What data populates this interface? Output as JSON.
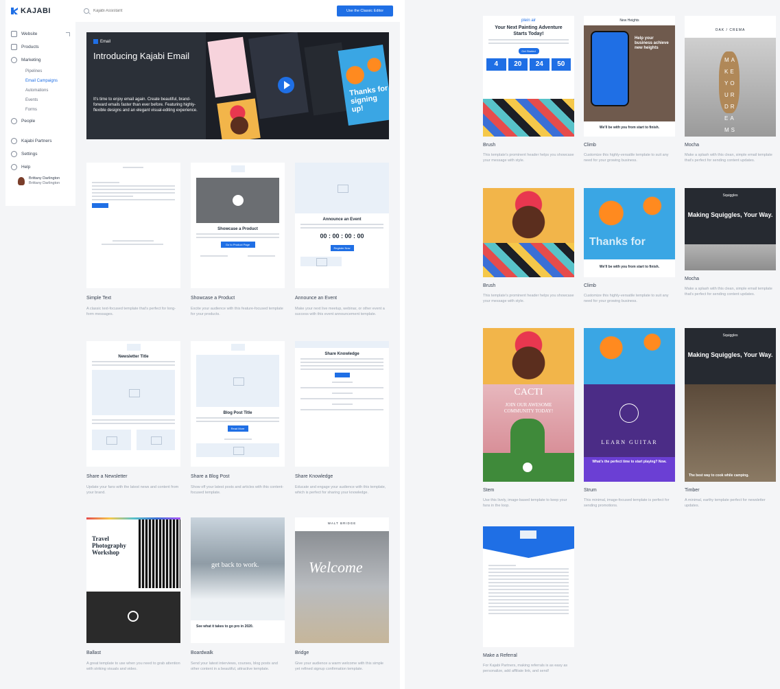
{
  "left": {
    "logo": "KAJABI",
    "nav": {
      "website": "Website",
      "products": "Products",
      "marketing": "Marketing",
      "marketing_sub": [
        "Pipelines",
        "Email Campaigns",
        "Automations",
        "Events",
        "Forms"
      ],
      "people": "People",
      "partners": "Kajabi Partners",
      "settings": "Settings",
      "help": "Help"
    },
    "profile": {
      "name": "Brittany Darlington",
      "sub": "Brittany Darlington"
    },
    "search": {
      "placeholder": "Kajabi Assistant"
    },
    "classic_button": "Use the Classic Editor",
    "hero": {
      "badge": "Email",
      "title": "Introducing Kajabi Email",
      "description": "It's time to enjoy email again. Create beautiful, brand-forward emails faster than ever before. Featuring highly-flexible designs and an elegant visual-editing experience.",
      "thanks": "Thanks for signing up!"
    },
    "templates": [
      {
        "name": "Simple Text",
        "desc": "A classic text-focused template that's perfect for long-form messages."
      },
      {
        "name": "Showcase a Product",
        "desc": "Excite your audience with this feature-focused template for your products.",
        "thumb_title": "Showcase a Product",
        "thumb_btn": "Go to Product Page"
      },
      {
        "name": "Announce an Event",
        "desc": "Make your next live meetup, webinar, or other event a success with this event announcement template.",
        "thumb_title": "Announce an Event",
        "countdown": "00 : 00 : 00 : 00",
        "thumb_btn": "Register Now"
      },
      {
        "name": "Share a Newsletter",
        "desc": "Update your fans with the latest news and content from your brand.",
        "thumb_title": "Newsletter Title"
      },
      {
        "name": "Share a Blog Post",
        "desc": "Show off your latest posts and articles with this content-focused template.",
        "thumb_title": "Blog Post Title",
        "thumb_btn": "Read More"
      },
      {
        "name": "Share Knowledge",
        "desc": "Educate and engage your audience with this template, which is perfect for sharing your knowledge.",
        "thumb_title": "Share Knowledge"
      },
      {
        "name": "Ballast",
        "desc": "A great template to use when you need to grab attention with striking visuals and video.",
        "thumb_title": "Travel Photography Workshop"
      },
      {
        "name": "Boardwalk",
        "desc": "Send your latest interviews, courses, blog posts and other content in a beautiful, attractive template.",
        "thumb_title": "get back to work.",
        "thumb_sub": "See what it takes to go pro in 2020."
      },
      {
        "name": "Bridge",
        "desc": "Give your audience a warm welcome with this simple yet refined signup confirmation template.",
        "thumb_title": "Welcome",
        "thumb_header": "WALT BRIDGE"
      }
    ]
  },
  "right": {
    "templates": [
      {
        "name": "Brush",
        "desc": "This template's prominent header helps you showcase your message with style.",
        "brand": "plein air",
        "thumb_title": "Your Next Painting Adventure Starts Today!",
        "thumb_btn": "Get Started",
        "counts": [
          "4",
          "20",
          "24",
          "50"
        ]
      },
      {
        "name": "Climb",
        "desc": "Customize this highly-versatile template to suit any need for your growing business.",
        "brand": "New Heights",
        "thumb_title": "Help your business achieve new heights",
        "thumb_foot": "We'll be with you from start to finish."
      },
      {
        "name": "Mocha",
        "desc": "Make a splash with this clean, simple email template that's perfect for sending content updates.",
        "brand": "OAK / CREMA",
        "thumb_title": "MAKE YOUR DREAMS PUNCH"
      },
      {
        "name": "Brush",
        "desc": "This template's prominent header helps you showcase your message with style."
      },
      {
        "name": "Climb",
        "desc": "Customize this highly-versatile template to suit any need for your growing business.",
        "thumb_title": "Thanks for",
        "thumb_foot": "We'll be with you from start to finish."
      },
      {
        "name": "Mocha",
        "desc": "Make a splash with this clean, simple email template that's perfect for sending content updates.",
        "brand": "Squiggles",
        "thumb_title": "Making Squiggles, Your Way."
      },
      {
        "name": "Stem",
        "desc": "Use this lively, image-based template to keep your fans in the loop.",
        "thumb_title": "CACTI",
        "thumb_sub": "JOIN OUR AWESOME COMMUNITY TODAY!"
      },
      {
        "name": "Strum",
        "desc": "This minimal, image-focused template is perfect for sending promotions.",
        "thumb_title": "LEARN GUITAR",
        "thumb_foot": "What's the perfect time to start playing? Now."
      },
      {
        "name": "Timber",
        "desc": "A minimal, earthy template perfect for newsletter updates.",
        "brand": "Squiggles",
        "thumb_title": "Making Squiggles, Your Way.",
        "thumb_foot": "The best way to cook while camping."
      },
      {
        "name": "Make a Referral",
        "desc": "For Kajabi Partners, making referrals is as easy as personalize, add affiliate link, and send!"
      }
    ]
  },
  "colors": {
    "accent": "#1f6fe5",
    "sidebar_bg": "#ffffff",
    "page_bg": "#f4f5f7"
  }
}
